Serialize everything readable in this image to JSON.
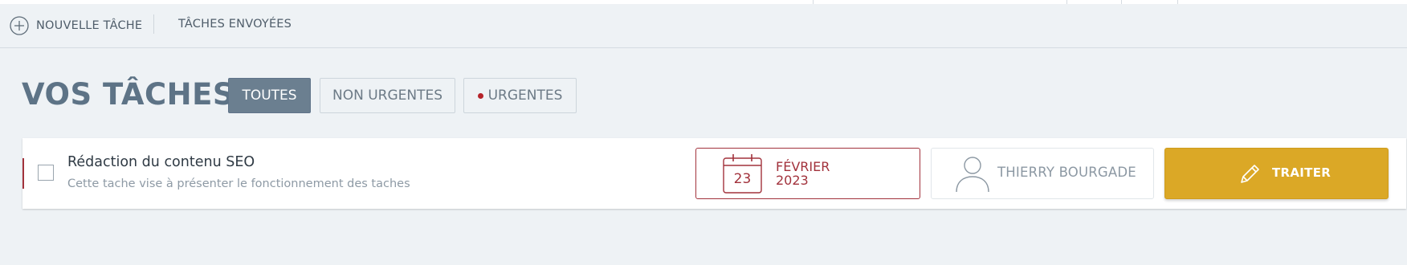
{
  "top_nav": {
    "new_task_label": "NOUVELLE TÂCHE",
    "new_task_icon": "plus-circle-icon",
    "sent_tasks_label": "TÂCHES ENVOYÉES"
  },
  "page": {
    "title": "VOS TÂCHES"
  },
  "filters": [
    {
      "label": "TOUTES",
      "active": true
    },
    {
      "label": "NON URGENTES",
      "active": false
    },
    {
      "label": "URGENTES",
      "active": false,
      "indicator_color": "#b5232a"
    }
  ],
  "tasks": [
    {
      "title": "Rédaction du contenu SEO",
      "description": "Cette tache vise à présenter le fonctionnement des taches",
      "checked": false,
      "urgent": true,
      "due_date": {
        "day": "23",
        "month": "FÉVRIER",
        "year": "2023"
      },
      "assignee": {
        "name": "THIERRY BOURGADE",
        "icon": "user-icon"
      },
      "action_label": "TRAITER",
      "action_icon": "pencil-icon"
    }
  ],
  "colors": {
    "background": "#eef2f5",
    "title": "#5d7386",
    "active_filter": "#6b7f90",
    "urgent": "#a2323c",
    "action": "#dba826"
  }
}
